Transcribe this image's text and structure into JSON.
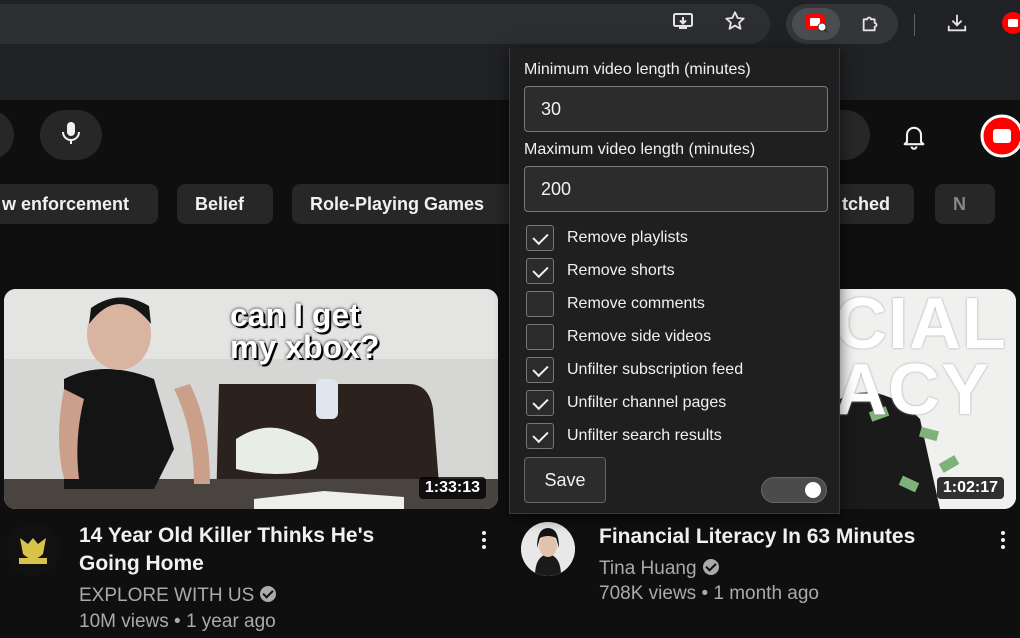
{
  "browser": {
    "toolbar_icons": [
      "install-app-icon",
      "bookmark-star-icon",
      "extension-filter-icon",
      "extensions-puzzle-icon",
      "downloads-icon",
      "youtube-extension-icon"
    ]
  },
  "youtube": {
    "header_icons": [
      "microphone-icon",
      "notifications-bell-icon"
    ],
    "chips": [
      "w enforcement",
      "Belief",
      "Role-Playing Games",
      "tched",
      "N"
    ],
    "videos": [
      {
        "thumb_text_line1": "can I get",
        "thumb_text_line2": "my xbox?",
        "duration": "1:33:13",
        "title_line1": "14 Year Old Killer Thinks He's",
        "title_line2": "Going Home",
        "channel": "EXPLORE WITH US",
        "stats": "10M views • 1 year ago"
      },
      {
        "thumb_text_line1": "CIAL",
        "thumb_text_line2": "ACY",
        "duration": "1:02:17",
        "title_line1": "Financial Literacy In 63 Minutes",
        "channel": "Tina Huang",
        "stats": "708K views • 1 month ago"
      }
    ]
  },
  "popup": {
    "min_label": "Minimum video length (minutes)",
    "min_value": "30",
    "max_label": "Maximum video length (minutes)",
    "max_value": "200",
    "options": [
      {
        "label": "Remove playlists",
        "checked": true
      },
      {
        "label": "Remove shorts",
        "checked": true
      },
      {
        "label": "Remove comments",
        "checked": false
      },
      {
        "label": "Remove side videos",
        "checked": false
      },
      {
        "label": "Unfilter subscription feed",
        "checked": true
      },
      {
        "label": "Unfilter channel pages",
        "checked": true
      },
      {
        "label": "Unfilter search results",
        "checked": true
      }
    ],
    "save_label": "Save",
    "toggle_on": true
  },
  "colors": {
    "page_bg": "#0f0f0f",
    "chrome_bg": "#202124",
    "popup_bg": "#1f1f1f",
    "youtube_red": "#ff0000"
  }
}
